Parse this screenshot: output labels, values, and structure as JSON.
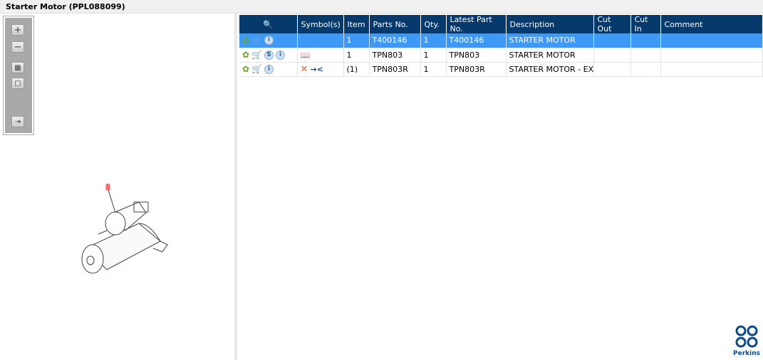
{
  "title": "Starter Motor (PPL088099)",
  "columns": [
    "Symbol(s)",
    "Item",
    "Parts No.",
    "Qty.",
    "Latest Part No.",
    "Description",
    "Cut Out",
    "Cut In",
    "Comment"
  ],
  "rows": [
    {
      "item": "1",
      "parts_no": "T400146",
      "qty": "1",
      "latest": "T400146",
      "description": "STARTER MOTOR",
      "cut_out": "",
      "cut_in": "",
      "comment": ""
    },
    {
      "item": "1",
      "parts_no": "TPN803",
      "qty": "1",
      "latest": "TPN803",
      "description": "STARTER MOTOR",
      "cut_out": "",
      "cut_in": "",
      "comment": ""
    },
    {
      "item": "(1)",
      "parts_no": "TPN803R",
      "qty": "1",
      "latest": "TPN803R",
      "description": "STARTER MOTOR - EXCHANGE",
      "cut_out": "",
      "cut_in": "",
      "comment": ""
    }
  ],
  "logo_text": "Perkins",
  "colors": {
    "header": "#063a6d",
    "selected": "#3d99f5"
  }
}
